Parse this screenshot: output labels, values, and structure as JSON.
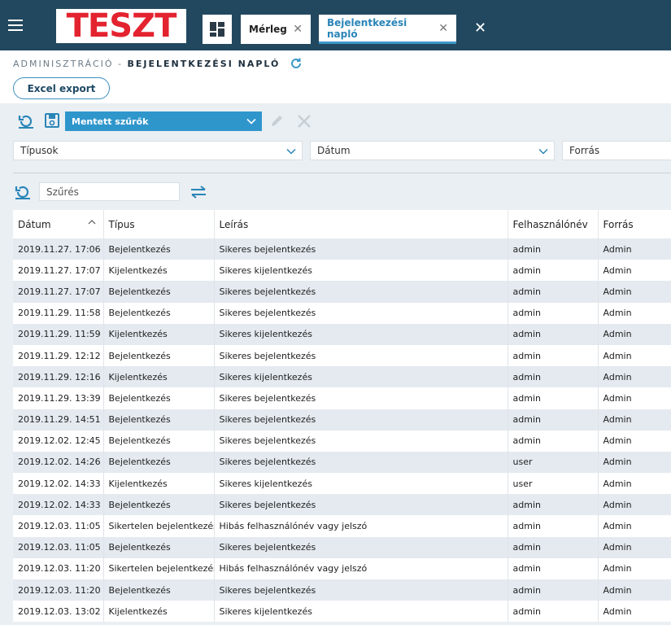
{
  "app": {
    "logo_text": "TESZT"
  },
  "tabs": [
    {
      "label": "Mérleg",
      "close": "✕"
    },
    {
      "label": "Bejelentkezési napló",
      "close": "✕"
    }
  ],
  "topbar": {
    "close": "✕"
  },
  "breadcrumb": {
    "section": "ADMINISZTRÁCIÓ - ",
    "current": "BEJELENTKEZÉSI NAPLÓ"
  },
  "toolbar": {
    "excel_label": "Excel export",
    "saved_filters_label": "Mentett szűrők"
  },
  "filters": {
    "types": "Típusok",
    "date": "Dátum",
    "source": "Forrás"
  },
  "search": {
    "placeholder": "Szűrés"
  },
  "colors": {
    "topbar": "#22485f",
    "accent": "#2f96cc",
    "logo_red": "#e3232f"
  },
  "table": {
    "columns": [
      "Dátum",
      "Típus",
      "Leírás",
      "Felhasználónév",
      "Forrás"
    ],
    "rows": [
      [
        "2019.11.27. 17:06",
        "Bejelentkezés",
        "Sikeres bejelentkezés",
        "admin",
        "Admin"
      ],
      [
        "2019.11.27. 17:07",
        "Kijelentkezés",
        "Sikeres kijelentkezés",
        "admin",
        "Admin"
      ],
      [
        "2019.11.27. 17:07",
        "Bejelentkezés",
        "Sikeres bejelentkezés",
        "admin",
        "Admin"
      ],
      [
        "2019.11.29. 11:58",
        "Bejelentkezés",
        "Sikeres bejelentkezés",
        "admin",
        "Admin"
      ],
      [
        "2019.11.29. 11:59",
        "Kijelentkezés",
        "Sikeres kijelentkezés",
        "admin",
        "Admin"
      ],
      [
        "2019.11.29. 12:12",
        "Bejelentkezés",
        "Sikeres bejelentkezés",
        "admin",
        "Admin"
      ],
      [
        "2019.11.29. 12:16",
        "Kijelentkezés",
        "Sikeres kijelentkezés",
        "admin",
        "Admin"
      ],
      [
        "2019.11.29. 13:39",
        "Bejelentkezés",
        "Sikeres bejelentkezés",
        "admin",
        "Admin"
      ],
      [
        "2019.11.29. 14:51",
        "Bejelentkezés",
        "Sikeres bejelentkezés",
        "admin",
        "Admin"
      ],
      [
        "2019.12.02. 12:45",
        "Bejelentkezés",
        "Sikeres bejelentkezés",
        "admin",
        "Admin"
      ],
      [
        "2019.12.02. 14:26",
        "Bejelentkezés",
        "Sikeres bejelentkezés",
        "user",
        "Admin"
      ],
      [
        "2019.12.02. 14:33",
        "Kijelentkezés",
        "Sikeres kijelentkezés",
        "user",
        "Admin"
      ],
      [
        "2019.12.02. 14:33",
        "Bejelentkezés",
        "Sikeres bejelentkezés",
        "admin",
        "Admin"
      ],
      [
        "2019.12.03. 11:05",
        "Sikertelen bejelentkezés",
        "Hibás felhasználónév vagy jelszó",
        "admin",
        "Admin"
      ],
      [
        "2019.12.03. 11:05",
        "Bejelentkezés",
        "Sikeres bejelentkezés",
        "admin",
        "Admin"
      ],
      [
        "2019.12.03. 11:20",
        "Sikertelen bejelentkezés",
        "Hibás felhasználónév vagy jelszó",
        "admin",
        "Admin"
      ],
      [
        "2019.12.03. 11:20",
        "Bejelentkezés",
        "Sikeres bejelentkezés",
        "admin",
        "Admin"
      ],
      [
        "2019.12.03. 13:02",
        "Kijelentkezés",
        "Sikeres kijelentkezés",
        "admin",
        "Admin"
      ]
    ]
  }
}
